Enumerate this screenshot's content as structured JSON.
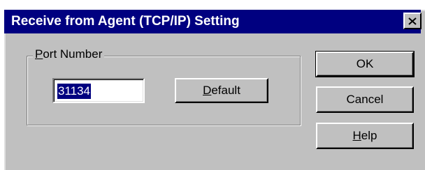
{
  "window": {
    "title": "Receive from Agent (TCP/IP) Setting",
    "close_icon": "close-icon"
  },
  "port_group": {
    "label_mnemonic": "P",
    "label_rest": "ort Number",
    "value": "31134"
  },
  "buttons": {
    "default_mnemonic": "D",
    "default_rest": "efault",
    "ok": "OK",
    "cancel": "Cancel",
    "help_mnemonic": "H",
    "help_rest": "elp"
  },
  "colors": {
    "titlebar": "#000080",
    "face": "#c0c0c0",
    "selection": "#000080"
  }
}
